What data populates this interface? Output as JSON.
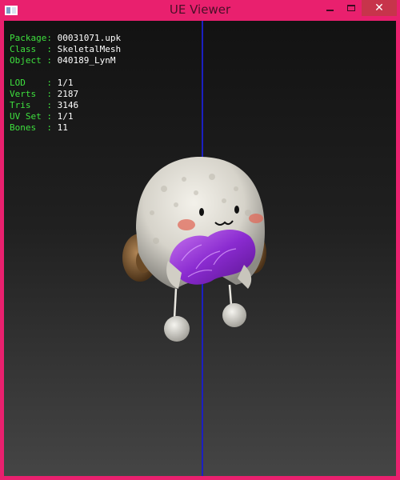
{
  "window": {
    "title": "UE Viewer",
    "minimize_symbol": "–",
    "close_symbol": "✕"
  },
  "info": {
    "package": {
      "label": "Package:",
      "value": "00031071.upk"
    },
    "class": {
      "label": "Class  :",
      "value": "SkeletalMesh"
    },
    "object": {
      "label": "Object :",
      "value": "040189_LynM"
    },
    "lod": {
      "label": "LOD    :",
      "value": "1/1"
    },
    "verts": {
      "label": "Verts  :",
      "value": "2187"
    },
    "tris": {
      "label": "Tris   :",
      "value": "3146"
    },
    "uvset": {
      "label": "UV Set :",
      "value": "1/1"
    },
    "bones": {
      "label": "Bones  :",
      "value": "11"
    }
  },
  "colors": {
    "window_frame": "#e9206e",
    "label_text": "#3ee03e",
    "value_text": "#ffffff",
    "axis_line": "#1b1fc2"
  }
}
